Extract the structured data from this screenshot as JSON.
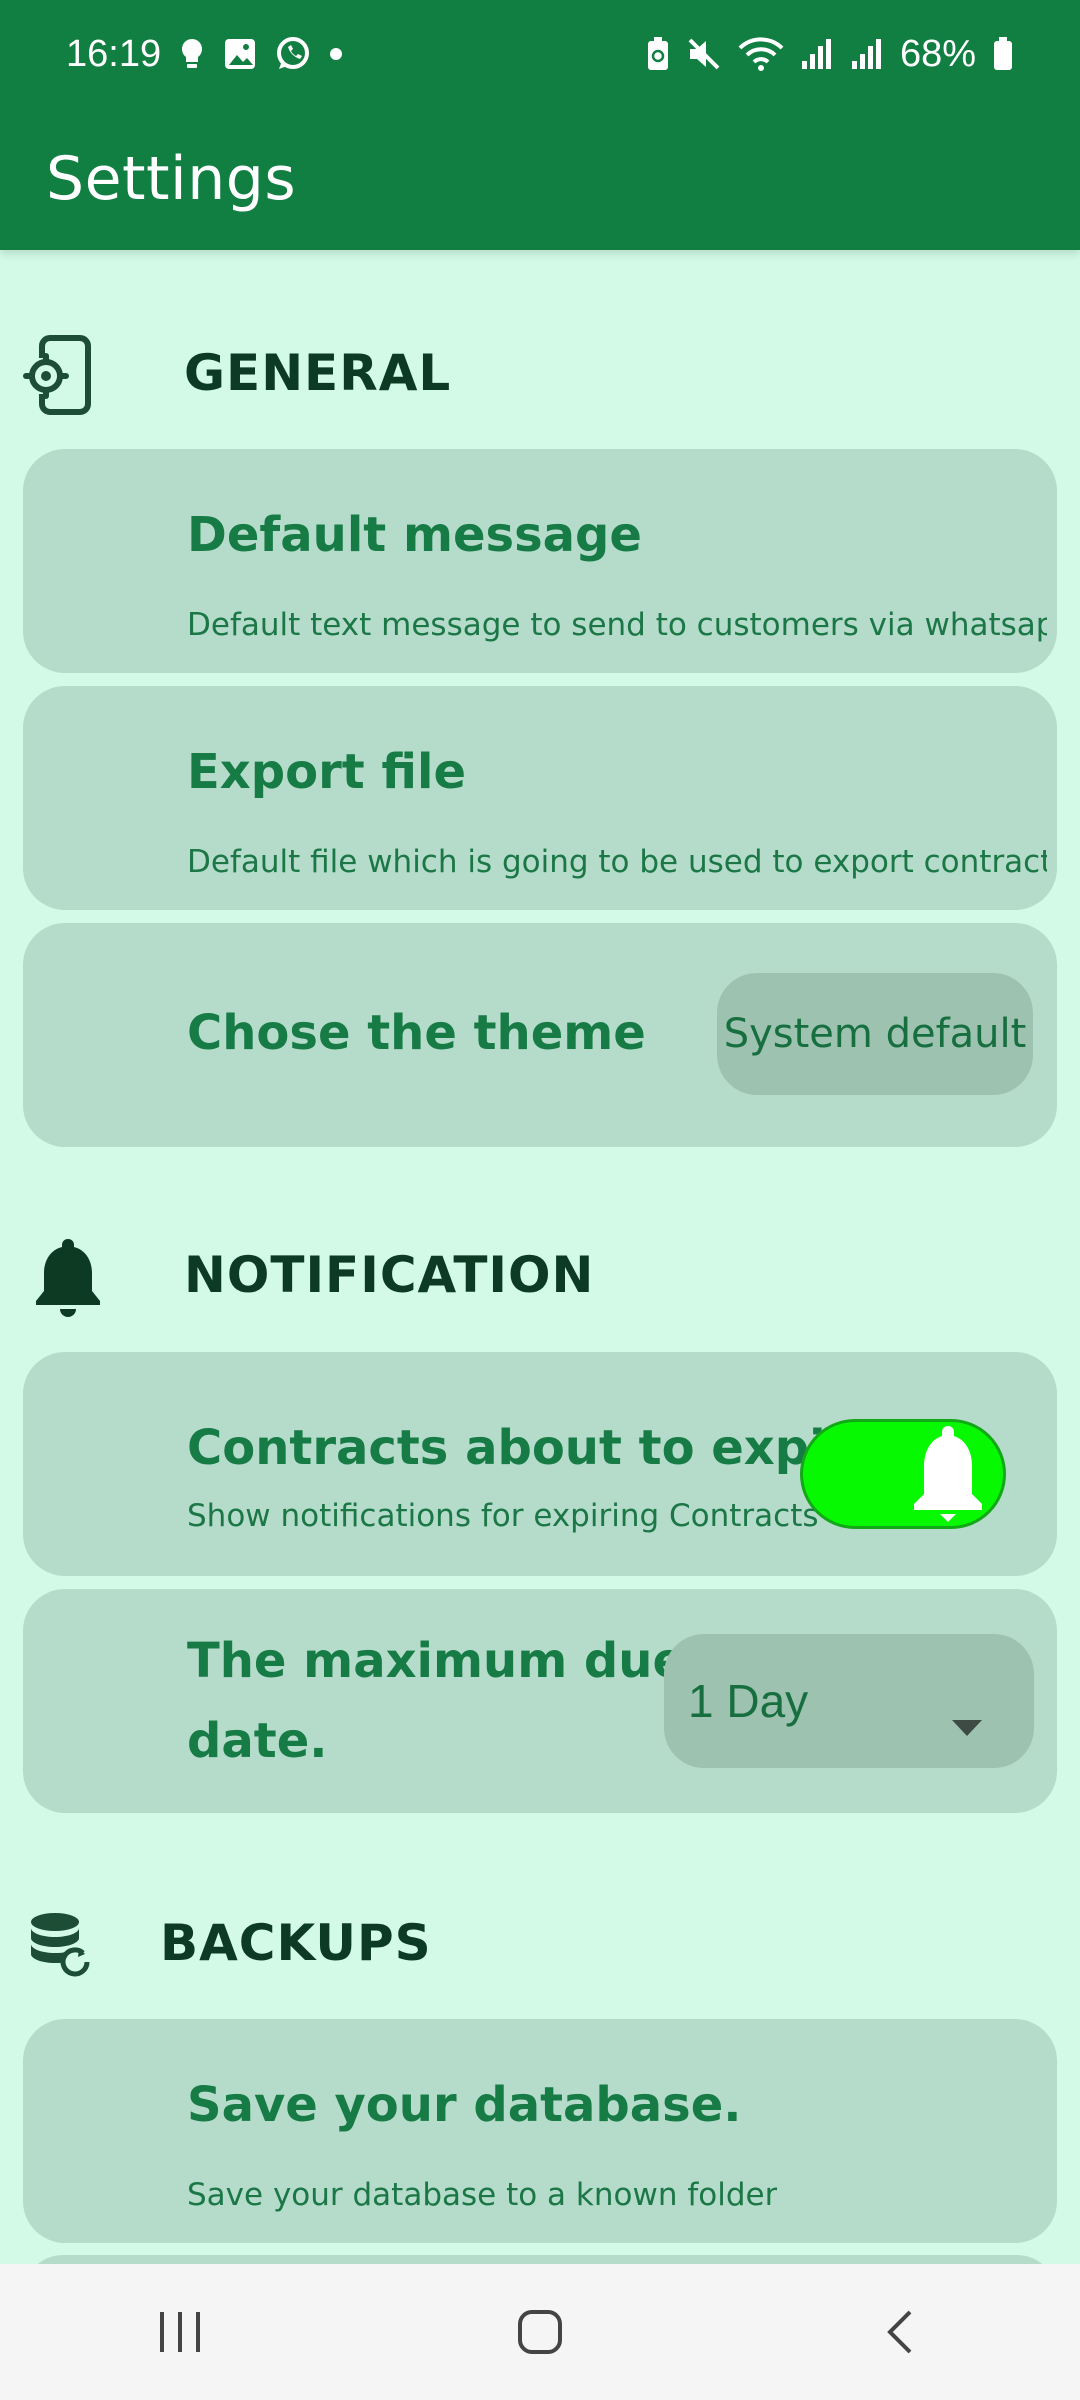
{
  "status_bar": {
    "time": "16:19",
    "battery": "68%"
  },
  "app_bar": {
    "title": "Settings"
  },
  "sections": {
    "general": {
      "title": "GENERAL",
      "icon": "settings-phone-icon",
      "default_message": {
        "title": "Default message",
        "subtitle": "Default text message to send to customers via whatsapp or .."
      },
      "export_file": {
        "title": "Export file",
        "subtitle": "Default file which is going to be used to export contracts"
      },
      "theme": {
        "title": "Chose the theme",
        "value": "System default"
      }
    },
    "notification": {
      "title": "NOTIFICATION",
      "icon": "bell-icon",
      "expire": {
        "title": "Contracts about to expire",
        "subtitle": "Show notifications for expiring Contracts",
        "enabled": true
      },
      "due_date": {
        "title_line1": "The maximum due",
        "title_line2": "date.",
        "value": "1 Day"
      }
    },
    "backups": {
      "title": "BACKUPS",
      "icon": "database-sync-icon",
      "save_db": {
        "title": "Save your database.",
        "subtitle": "Save your database to a known folder"
      }
    }
  },
  "colors": {
    "primary": "#127f42",
    "background": "#d2fae7",
    "card": "#b5dccb",
    "toggle_on": "#07f902"
  }
}
